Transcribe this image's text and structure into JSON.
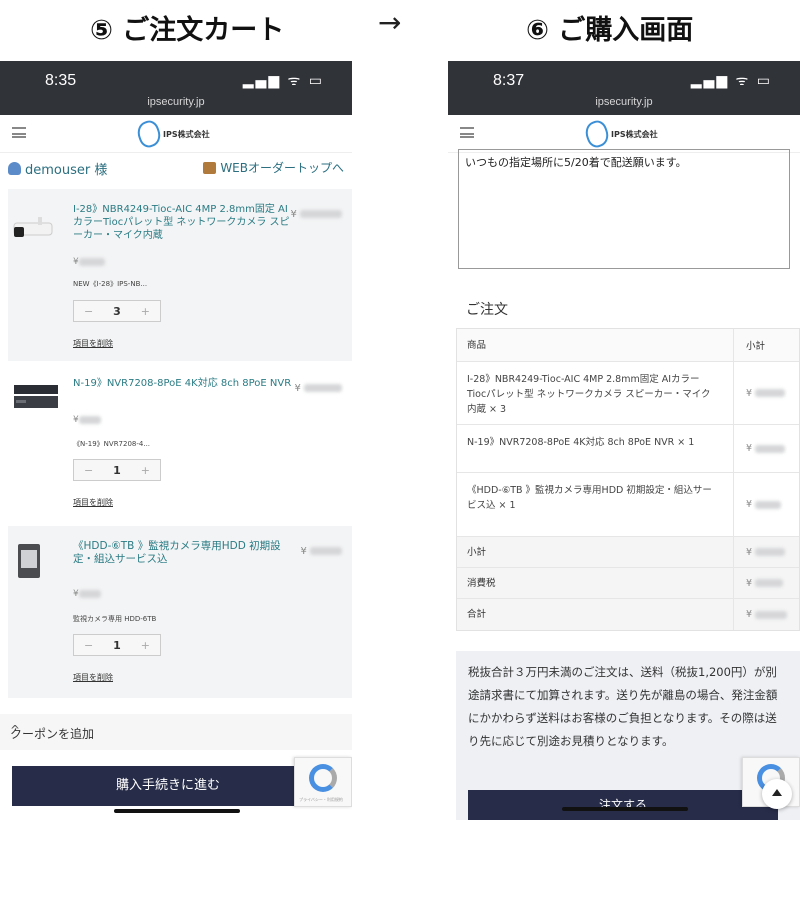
{
  "headings": {
    "left": "⑤ ご注文カート",
    "arrow": "→",
    "right": "⑥ ご購入画面"
  },
  "left_phone": {
    "time": "8:35",
    "signal": "▂▄▆ ᯤ ▭",
    "url": "ipsecurity.jp",
    "logo_text": "IPS株式会社",
    "user_label": "demouser 様",
    "web_top_link": "WEBオーダートップへ",
    "items": [
      {
        "name": "I-28》NBR4249-Tioc-AIC 4MP 2.8mm固定 AIカラーTiocパレット型 ネットワークカメラ スピーカー・マイク内蔵",
        "price_prefix": "¥",
        "unit_prefix": "¥",
        "sku": "NEW《I-28》IPS-NB...",
        "qty": "3",
        "delete": "項目を削除"
      },
      {
        "name": "N-19》NVR7208-8PoE 4K対応 8ch 8PoE NVR",
        "price_prefix": "¥",
        "unit_prefix": "¥",
        "sku": "《N-19》NVR7208-4...",
        "qty": "1",
        "delete": "項目を削除"
      },
      {
        "name": "《HDD-⑥TB 》監視カメラ専用HDD 初期設定・組込サービス込",
        "price_prefix": "¥",
        "unit_prefix": "¥",
        "sku": "監視カメラ専用 HDD-6TB",
        "qty": "1",
        "delete": "項目を削除"
      }
    ],
    "stepper_minus": "−",
    "stepper_plus": "+",
    "coupon_label": "クーポンを追加",
    "coupon_chevron": "^",
    "checkout_button": "購入手続きに進む",
    "recaptcha_note": "プライバシー・利用規約"
  },
  "right_phone": {
    "time": "8:37",
    "signal": "▂▄▆ ᯤ ▭",
    "url": "ipsecurity.jp",
    "logo_text": "IPS株式会社",
    "note_text": "いつもの指定場所に5/20着で配送願います。",
    "order_heading": "ご注文",
    "table": {
      "col_product": "商品",
      "col_subtotal": "小計",
      "rows": [
        {
          "name": "I-28》NBR4249-Tioc-AIC 4MP 2.8mm固定 AIカラーTiocパレット型 ネットワークカメラ スピーカー・マイク内蔵 × 3",
          "price_prefix": "¥"
        },
        {
          "name": "N-19》NVR7208-8PoE 4K対応 8ch 8PoE NVR × 1",
          "price_prefix": "¥"
        },
        {
          "name": "《HDD-⑥TB 》監視カメラ専用HDD 初期設定・組込サービス込 × 1",
          "price_prefix": "¥"
        }
      ],
      "summary": [
        {
          "label": "小計",
          "price_prefix": "¥"
        },
        {
          "label": "消費税",
          "price_prefix": "¥"
        },
        {
          "label": "合計",
          "price_prefix": "¥"
        }
      ]
    },
    "notice": "税抜合計３万円未満のご注文は、送料（税抜1,200円）が別途請求書にて加算されます。送り先が離島の場合、発注金額にかかわらず送料はお客様のご負担となります。その際は送り先に応じて別途お見積りとなります。",
    "order_button": "注文する"
  }
}
